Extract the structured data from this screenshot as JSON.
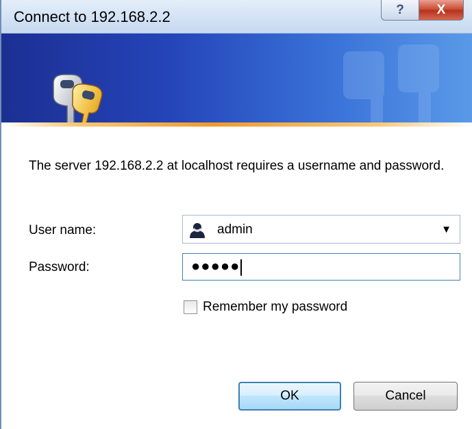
{
  "window": {
    "title": "Connect to 192.168.2.2",
    "help_label": "?",
    "close_label": "X"
  },
  "message": "The server 192.168.2.2 at localhost requires a username and password.",
  "form": {
    "username_label": "User name:",
    "username_value": "admin",
    "password_label": "Password:",
    "password_masked": "●●●●●",
    "remember_label": "Remember my password",
    "remember_checked": false
  },
  "buttons": {
    "ok_label": "OK",
    "cancel_label": "Cancel"
  },
  "icons": {
    "banner": "keys-icon",
    "user": "user-icon",
    "dropdown": "chevron-down-icon"
  },
  "colors": {
    "banner_dark": "#1c2f93",
    "banner_light": "#5a9ae8",
    "accent_orange": "#ef9a2c",
    "focus_border": "#3c7fb1",
    "close_red": "#c7472d"
  }
}
